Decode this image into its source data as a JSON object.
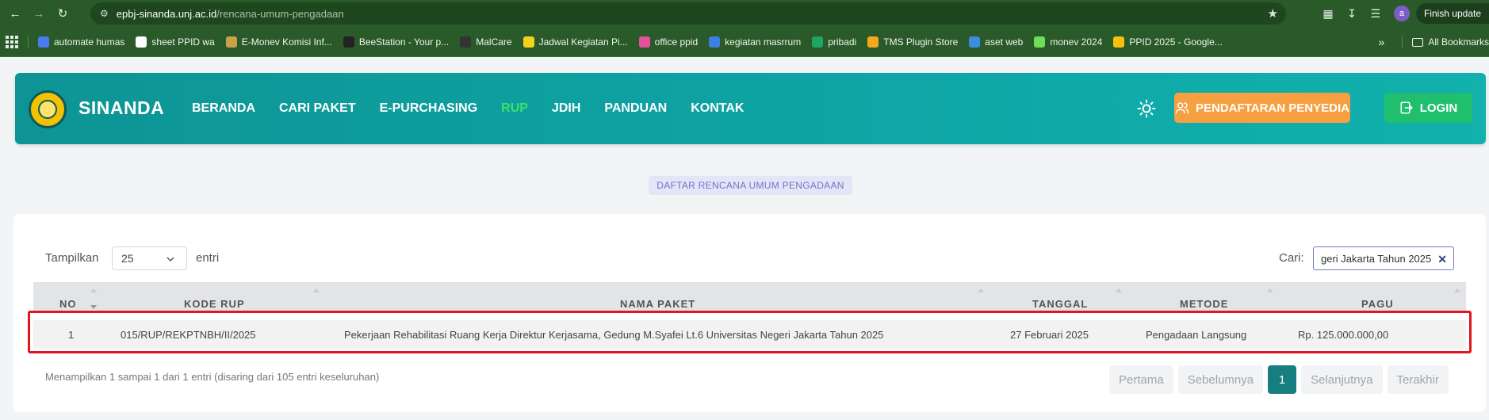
{
  "browser": {
    "url_host": "epbj-sinanda.unj.ac.id",
    "url_path": "/rencana-umum-pengadaan",
    "profile_initial": "a",
    "finish_update_label": "Finish update",
    "bookmarks": [
      {
        "label": "automate humas",
        "color": "#4a7cf0"
      },
      {
        "label": "sheet PPID wa",
        "color": "#ffffff"
      },
      {
        "label": "E-Monev Komisi Inf...",
        "color": "#c9a24a"
      },
      {
        "label": "BeeStation - Your p...",
        "color": "#222222"
      },
      {
        "label": "MalCare",
        "color": "#333333"
      },
      {
        "label": "Jadwal Kegiatan Pi...",
        "color": "#f2d21c"
      },
      {
        "label": "office ppid",
        "color": "#e2539b"
      },
      {
        "label": "kegiatan masrrum",
        "color": "#3b7fe0"
      },
      {
        "label": "pribadi",
        "color": "#1fa463"
      },
      {
        "label": "TMS Plugin Store",
        "color": "#f2a91c"
      },
      {
        "label": "aset web",
        "color": "#3a8dde"
      },
      {
        "label": "monev 2024",
        "color": "#6fdc5a"
      },
      {
        "label": "PPID 2025 - Google...",
        "color": "#f4c20d"
      }
    ],
    "all_bookmarks_label": "All Bookmarks"
  },
  "header": {
    "brand": "SINANDA",
    "nav": [
      {
        "label": "BERANDA",
        "active": false
      },
      {
        "label": "CARI PAKET",
        "active": false
      },
      {
        "label": "E-PURCHASING",
        "active": false
      },
      {
        "label": "RUP",
        "active": true
      },
      {
        "label": "JDIH",
        "active": false
      },
      {
        "label": "PANDUAN",
        "active": false
      },
      {
        "label": "KONTAK",
        "active": false
      }
    ],
    "register_label": "PENDAFTARAN PENYEDIA",
    "login_label": "LOGIN"
  },
  "section_title": "DAFTAR RENCANA UMUM PENGADAAN",
  "table_controls": {
    "show_label": "Tampilkan",
    "page_length": "25",
    "entries_label": "entri",
    "search_label": "Cari:",
    "search_value": "geri Jakarta Tahun 2025"
  },
  "table": {
    "columns": [
      "NO",
      "KODE RUP",
      "NAMA PAKET",
      "TANGGAL",
      "METODE",
      "PAGU"
    ],
    "rows": [
      {
        "no": "1",
        "kode_rup": "015/RUP/REKPTNBH/II/2025",
        "nama_paket": "Pekerjaan Rehabilitasi Ruang Kerja Direktur Kerjasama, Gedung M.Syafei Lt.6 Universitas Negeri Jakarta Tahun 2025",
        "tanggal": "27 Februari 2025",
        "metode": "Pengadaan Langsung",
        "pagu": "Rp. 125.000.000,00"
      }
    ]
  },
  "info_text": "Menampilkan 1 sampai 1 dari 1 entri (disaring dari 105 entri keseluruhan)",
  "pagination": {
    "first": "Pertama",
    "prev": "Sebelumnya",
    "current": "1",
    "next": "Selanjutnya",
    "last": "Terakhir"
  },
  "colors": {
    "header_teal": "#0ea6a6",
    "active_nav": "#39e26b",
    "register_orange": "#f7a041",
    "login_green": "#1fbf6e",
    "highlight_red": "#e0161c",
    "page_current": "#167e7e"
  }
}
